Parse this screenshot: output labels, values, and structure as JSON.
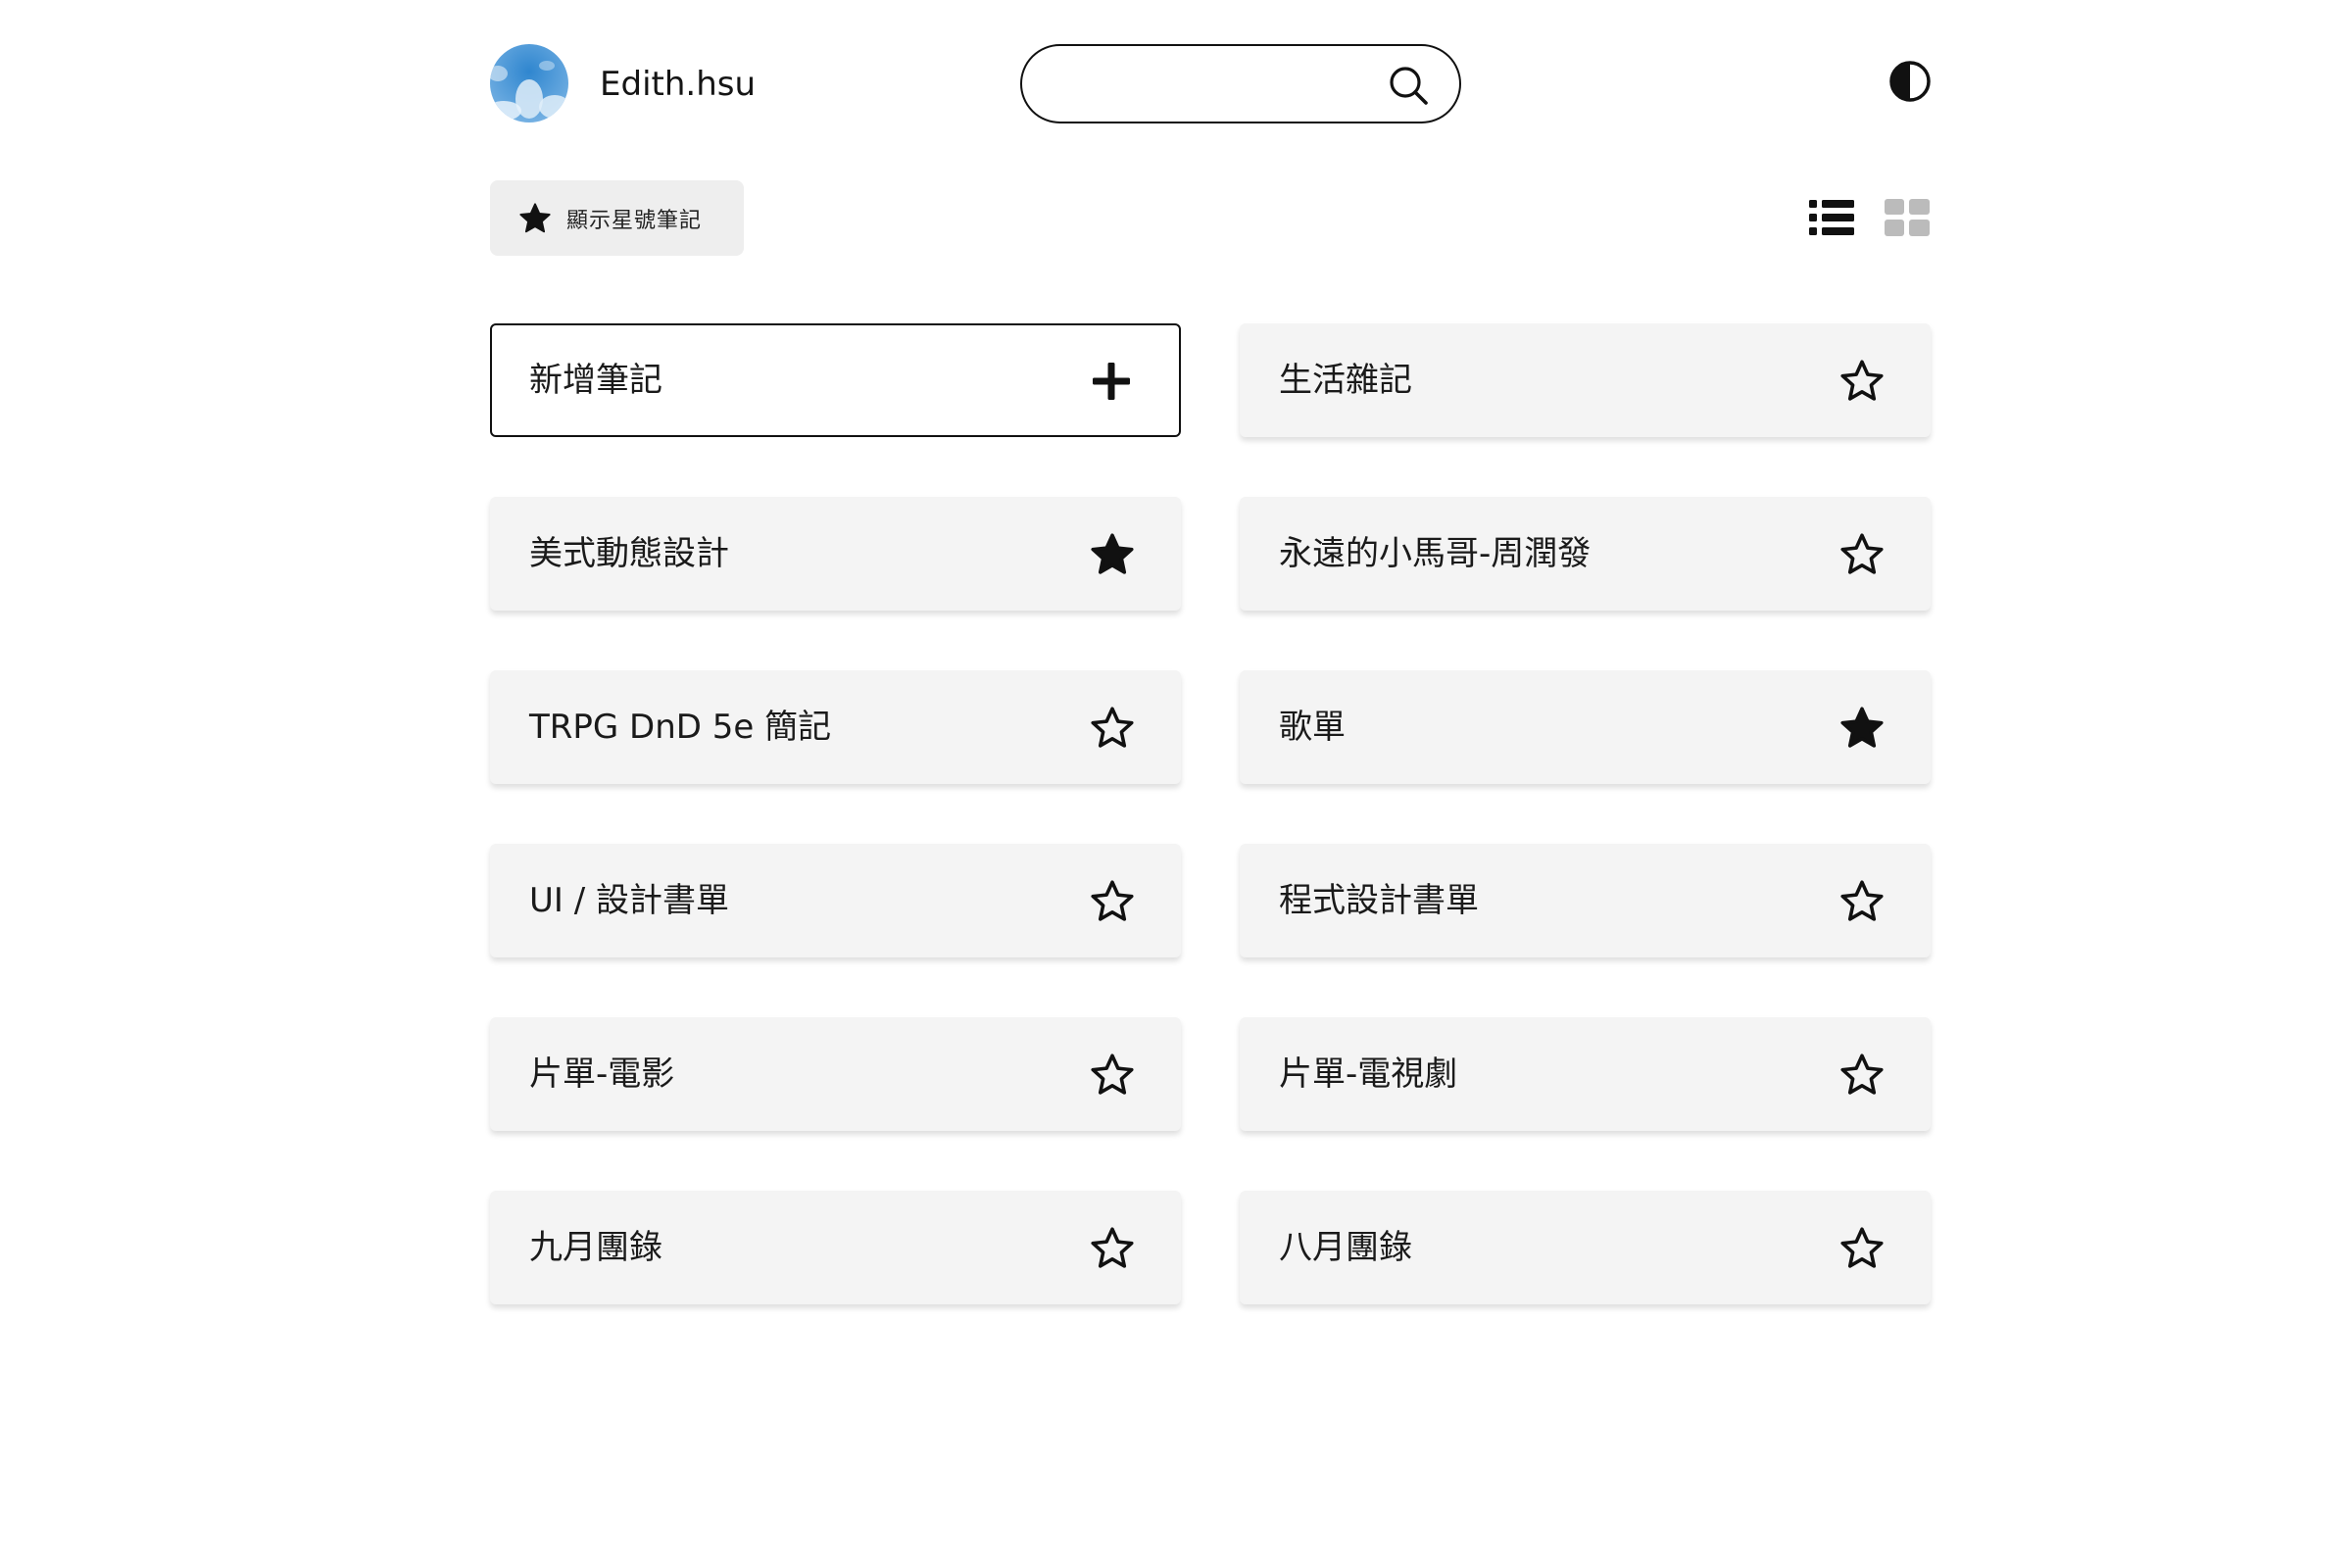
{
  "header": {
    "username": "Edith.hsu",
    "search_placeholder": "",
    "avatar_icon": "avatar-sky-clouds",
    "search_icon": "search-icon",
    "theme_icon": "contrast-icon"
  },
  "toolbar": {
    "starred_filter_label": "顯示星號筆記",
    "starred_filter_icon": "star-filled-icon",
    "view_modes": [
      {
        "name": "list",
        "icon": "list-icon",
        "active": true
      },
      {
        "name": "grid",
        "icon": "grid-icon",
        "active": false
      }
    ]
  },
  "notes": {
    "new_note": {
      "label": "新增筆記",
      "icon": "plus-icon"
    },
    "items": [
      {
        "title": "生活雜記",
        "starred": false
      },
      {
        "title": "美式動態設計",
        "starred": true
      },
      {
        "title": "永遠的小馬哥-周潤發",
        "starred": false
      },
      {
        "title": "TRPG DnD 5e 簡記",
        "starred": false
      },
      {
        "title": "歌單",
        "starred": true
      },
      {
        "title": "UI / 設計書單",
        "starred": false
      },
      {
        "title": "程式設計書單",
        "starred": false
      },
      {
        "title": "片單-電影",
        "starred": false
      },
      {
        "title": "片單-電視劇",
        "starred": false
      },
      {
        "title": "九月團錄",
        "starred": false
      },
      {
        "title": "八月團錄",
        "starred": false
      }
    ]
  },
  "colors": {
    "card_background": "#f4f4f4",
    "filter_background": "#eeeeee",
    "inactive_icon": "#bbbbbb",
    "text": "#1a1a1a",
    "avatar_sky": "#3d92d4"
  }
}
